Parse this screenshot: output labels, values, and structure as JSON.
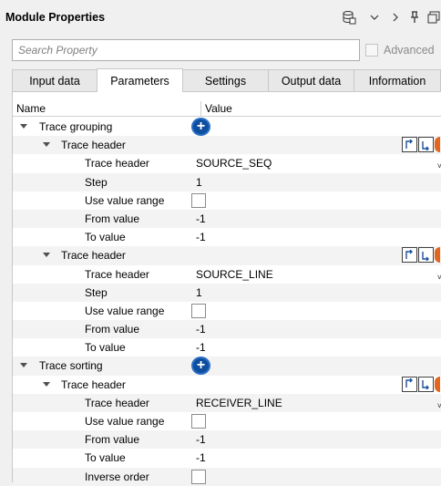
{
  "window": {
    "title": "Module Properties"
  },
  "search": {
    "placeholder": "Search Property",
    "advanced_label": "Advanced"
  },
  "tabs": [
    {
      "label": "Input data",
      "active": false
    },
    {
      "label": "Parameters",
      "active": true
    },
    {
      "label": "Settings",
      "active": false
    },
    {
      "label": "Output data",
      "active": false
    },
    {
      "label": "Information",
      "active": false
    }
  ],
  "table": {
    "col_name": "Name",
    "col_value": "Value",
    "rows": [
      {
        "label": "Trace grouping",
        "level": 0,
        "kind": "group-add"
      },
      {
        "label": "Trace header",
        "level": 1,
        "kind": "subgroup"
      },
      {
        "label": "Trace header",
        "level": 2,
        "kind": "combo",
        "value": "SOURCE_SEQ"
      },
      {
        "label": "Step",
        "level": 2,
        "kind": "text",
        "value": "1"
      },
      {
        "label": "Use value range",
        "level": 2,
        "kind": "check",
        "checked": false
      },
      {
        "label": "From value",
        "level": 2,
        "kind": "text",
        "value": "-1"
      },
      {
        "label": "To value",
        "level": 2,
        "kind": "text",
        "value": "-1"
      },
      {
        "label": "Trace header",
        "level": 1,
        "kind": "subgroup"
      },
      {
        "label": "Trace header",
        "level": 2,
        "kind": "combo",
        "value": "SOURCE_LINE"
      },
      {
        "label": "Step",
        "level": 2,
        "kind": "text",
        "value": "1"
      },
      {
        "label": "Use value range",
        "level": 2,
        "kind": "check",
        "checked": false
      },
      {
        "label": "From value",
        "level": 2,
        "kind": "text",
        "value": "-1"
      },
      {
        "label": "To value",
        "level": 2,
        "kind": "text",
        "value": "-1"
      },
      {
        "label": "Trace sorting",
        "level": 0,
        "kind": "group-add"
      },
      {
        "label": "Trace header",
        "level": 1,
        "kind": "subgroup"
      },
      {
        "label": "Trace header",
        "level": 2,
        "kind": "combo",
        "value": "RECEIVER_LINE"
      },
      {
        "label": "Use value range",
        "level": 2,
        "kind": "check",
        "checked": false
      },
      {
        "label": "From value",
        "level": 2,
        "kind": "text",
        "value": "-1"
      },
      {
        "label": "To value",
        "level": 2,
        "kind": "text",
        "value": "-1"
      },
      {
        "label": "Inverse order",
        "level": 2,
        "kind": "check",
        "checked": false
      }
    ]
  },
  "colors": {
    "accent_blue": "#0d4f9e",
    "stripe": "#f3f3f3",
    "border": "#c8c8c8"
  }
}
